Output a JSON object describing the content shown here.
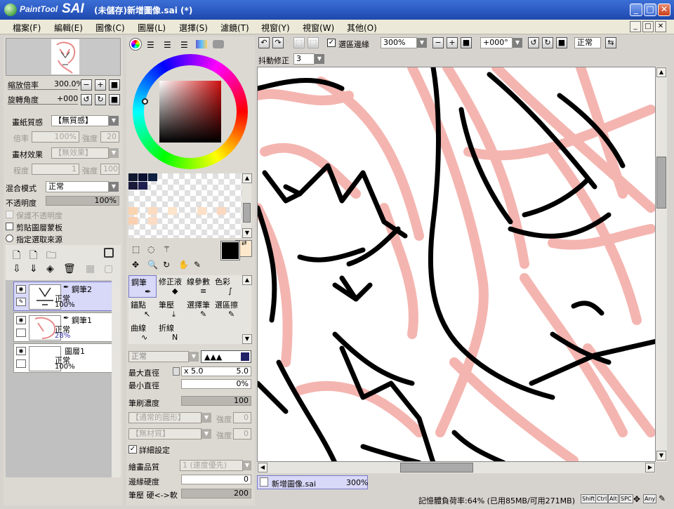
{
  "app": {
    "logo_text": "PaintTool",
    "logo_brand": "SAI",
    "window_title": "(未儲存)新增圖像.sai (*)",
    "window_buttons": [
      "_",
      "□",
      "✕"
    ]
  },
  "menu": {
    "items": [
      "檔案(F)",
      "編輯(E)",
      "圖像(C)",
      "圖層(L)",
      "選擇(S)",
      "濾鏡(T)",
      "視窗(Y)",
      "視窗(W)",
      "其他(O)"
    ],
    "mdi_buttons": [
      "_",
      "□",
      "✕"
    ]
  },
  "navigator": {
    "zoom_label": "縮放倍率",
    "zoom_value": "300.0%",
    "rotate_label": "旋轉角度",
    "rotate_value": "+000"
  },
  "canvas_props": {
    "paper_texture_label": "畫紙質感",
    "paper_texture_value": "【無質感】",
    "scale_label": "倍率",
    "scale_value": "100%",
    "strength_label": "強度",
    "strength_value_1": "20",
    "material_effect_label": "畫材效果",
    "material_effect_value": "【無效果】",
    "degree_label": "程度",
    "degree_value": "1",
    "strength_value_2": "100"
  },
  "layer_props": {
    "blend_label": "混合模式",
    "blend_value": "正常",
    "opacity_label": "不透明度",
    "opacity_value": "100%",
    "opacity_fraction": 1.0,
    "preserve_opacity": "保護不透明度",
    "clip_group": "剪貼圖層蒙板",
    "selection_source": "指定選取來源"
  },
  "layers": [
    {
      "name": "鋼筆2",
      "mode": "正常",
      "opacity": "100%",
      "selected": true
    },
    {
      "name": "鋼筆1",
      "mode": "正常",
      "opacity": "28%",
      "selected": false
    },
    {
      "name": "圖層1",
      "mode": "正常",
      "opacity": "100%",
      "selected": false
    }
  ],
  "tools": {
    "row1": [
      "鋼筆",
      "修正液",
      "線參數",
      "色彩"
    ],
    "row2": [
      "錨點",
      "筆壓",
      "選擇筆",
      "選區擦"
    ],
    "row3": [
      "曲線",
      "折線"
    ],
    "selected": "鋼筆"
  },
  "brush": {
    "mode_value": "正常",
    "max_size_label": "最大直徑",
    "max_size_mult": "x 5.0",
    "max_size_value": "5.0",
    "min_size_label": "最小直徑",
    "min_size_value": "0%",
    "density_label": "筆刷濃度",
    "density_value": "100",
    "density_fraction": 1.0,
    "shape_value": "【通常的圓形】",
    "shape_strength_label": "強度",
    "shape_strength_value": "0",
    "texture_value": "【無材質】",
    "texture_strength_label": "強度",
    "texture_strength_value": "0",
    "advanced_label": "詳細設定",
    "quality_label": "繪畫品質",
    "quality_value": "1 (速度優先)",
    "edge_label": "邊緣硬度",
    "edge_value": "0",
    "min_density_label": "筆壓 硬<->軟",
    "min_density_value": "200"
  },
  "canvas_toolbar": {
    "selection_edge_label": "選區邊緣",
    "zoom_value": "300%",
    "angle_value": "+000°",
    "mode_value": "正常",
    "stabilizer_label": "抖動修正",
    "stabilizer_value": "3"
  },
  "doc_tab": {
    "name": "新增圖像.sai",
    "zoom": "300%"
  },
  "statusbar": {
    "memory": "記憶體負荷率:64% (已用85MB/可用271MB)",
    "keys": [
      "Shift",
      "Ctrl",
      "Alt",
      "SPC",
      "Any"
    ]
  },
  "colors": {
    "title_bar": "#2a58c0",
    "selected_bg": "#d8d8f8",
    "primary_color": "#000000",
    "secondary_color": "#fde8cc",
    "sketch_pink": "#f4b5b0"
  },
  "icons": {
    "undo": "undo-icon",
    "redo": "redo-icon",
    "zoom_in": "plus-icon",
    "zoom_out": "minus-icon",
    "reset": "reset-icon",
    "flip": "flip-icon"
  }
}
